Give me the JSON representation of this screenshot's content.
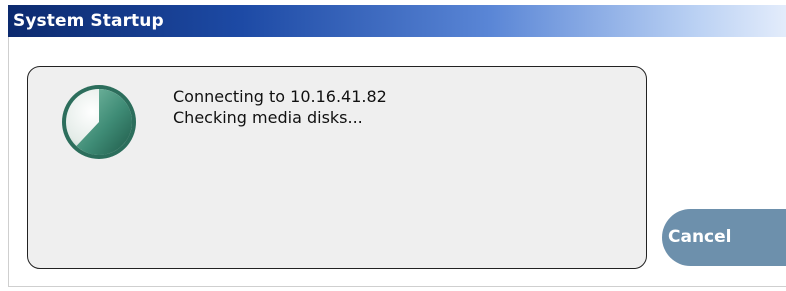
{
  "window": {
    "title": "System Startup"
  },
  "status": {
    "line1": "Connecting to 10.16.41.82",
    "line2": "Checking media disks..."
  },
  "progress": {
    "icon": "pie-progress-icon",
    "fraction": 0.62
  },
  "buttons": {
    "cancel_label": "Cancel"
  },
  "colors": {
    "titlebar_start": "#0c2a6e",
    "titlebar_end": "#e3ecfb",
    "panel_bg": "#efefef",
    "cancel_bg": "#6d90ac",
    "pie_fill": "#3f8c76"
  }
}
